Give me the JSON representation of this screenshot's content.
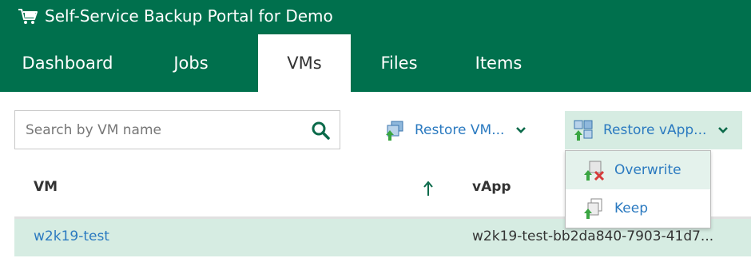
{
  "header": {
    "title": "Self-Service Backup Portal for Demo",
    "logo_icon": "cart-icon",
    "background": "#00704d"
  },
  "tabs": [
    {
      "label": "Dashboard",
      "active": false
    },
    {
      "label": "Jobs",
      "active": false
    },
    {
      "label": "VMs",
      "active": true
    },
    {
      "label": "Files",
      "active": false
    },
    {
      "label": "Items",
      "active": false
    }
  ],
  "search": {
    "placeholder": "Search by VM name",
    "value": "",
    "icon": "search-icon"
  },
  "toolbar": {
    "restore_vm_label": "Restore VM...",
    "restore_vapp_label": "Restore vApp...",
    "restore_vm_icon": "restore-vm-icon",
    "restore_vapp_icon": "restore-vapp-icon"
  },
  "restore_vapp_menu": {
    "items": [
      {
        "label": "Overwrite",
        "icon": "overwrite-icon"
      },
      {
        "label": "Keep",
        "icon": "keep-icon"
      }
    ]
  },
  "table": {
    "columns": [
      "VM",
      "vApp"
    ],
    "sort": {
      "column": "VM",
      "direction": "ascending"
    },
    "rows": [
      {
        "vm": "w2k19-test",
        "vapp": "w2k19-test-bb2da840-7903-41d7..."
      }
    ]
  },
  "colors": {
    "accent": "#00704d",
    "link": "#2b7ac0",
    "selection": "#d6ece2"
  }
}
